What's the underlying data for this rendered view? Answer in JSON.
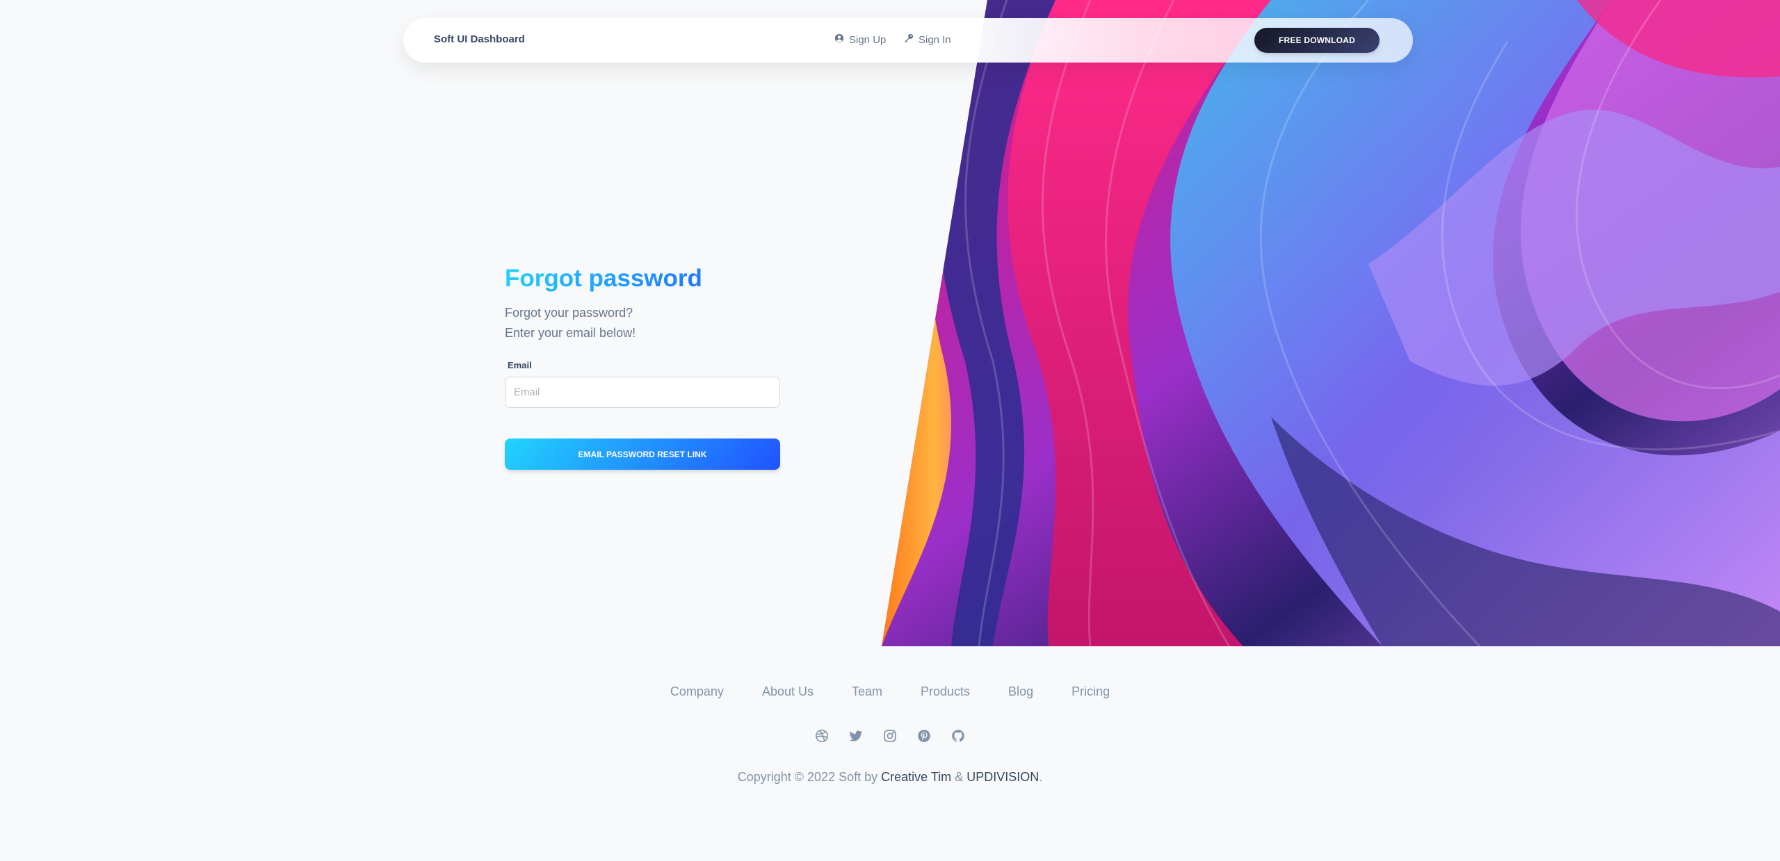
{
  "navbar": {
    "brand": "Soft UI Dashboard",
    "links": [
      {
        "label": "Sign Up",
        "icon": "user-circle-icon"
      },
      {
        "label": "Sign In",
        "icon": "key-icon"
      }
    ],
    "download_button": "FREE DOWNLOAD"
  },
  "form": {
    "title": "Forgot password",
    "subtitle_line1": "Forgot your password?",
    "subtitle_line2": "Enter your email below!",
    "email_label": "Email",
    "email_placeholder": "Email",
    "email_value": "",
    "submit_label": "EMAIL PASSWORD RESET LINK"
  },
  "hero": {
    "image": "abstract colorful waves artwork"
  },
  "footer": {
    "links": [
      "Company",
      "About Us",
      "Team",
      "Products",
      "Blog",
      "Pricing"
    ],
    "socials": [
      "dribbble-icon",
      "twitter-icon",
      "instagram-icon",
      "pinterest-icon",
      "github-icon"
    ],
    "copyright_prefix": "Copyright © 2022 Soft by",
    "author1": "Creative Tim",
    "amp": "&",
    "author2": "UPDIVISION",
    "suffix": "."
  },
  "colors": {
    "gradient_start": "#21d4fd",
    "gradient_end": "#2152ff",
    "dark_button": "#141727",
    "heading": "#344767",
    "text": "#67748e",
    "background": "#f8f9fa"
  }
}
